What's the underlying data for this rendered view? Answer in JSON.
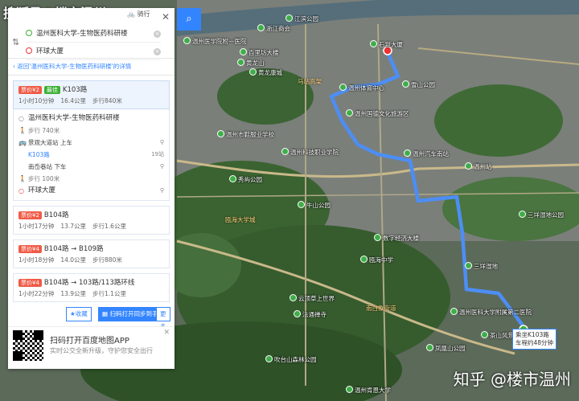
{
  "watermark_top": "搜狐号@楼市温州",
  "watermark_bottom": "知乎 @楼市温州",
  "search": {
    "mode_label": "骑行",
    "start": "温州医科大学-生物医药科研楼",
    "end": "环球大厦"
  },
  "back_link": "返回'温州医科大学-生物医药科研楼'的详情",
  "plans": [
    {
      "badge1": "票价¥2",
      "badge2": "最佳",
      "route": "K103路",
      "time": "1小时10分钟",
      "distance": "16.4公里",
      "walk": "步行840米"
    },
    {
      "badge1": "票价¥2",
      "route": "B104路",
      "time": "1小时17分钟",
      "distance": "13.7公里",
      "walk": "步行1.6公里"
    },
    {
      "badge1": "票价¥4",
      "route": "B104路 → B109路",
      "time": "1小时18分钟",
      "distance": "14.0公里",
      "walk": "步行880米"
    },
    {
      "badge1": "票价¥4",
      "route": "B104路 → 103路/113路环线",
      "time": "1小时22分钟",
      "distance": "13.9公里",
      "walk": "步行1.1公里"
    }
  ],
  "steps": [
    {
      "text": "温州医科大学-生物医药科研楼",
      "right": ""
    },
    {
      "text": "步行 740米",
      "right": ""
    },
    {
      "text": "景观大道站 上车",
      "right": ""
    },
    {
      "text": "K103路",
      "right": "19站"
    },
    {
      "text": "南岙巷站 下车",
      "right": ""
    },
    {
      "text": "步行 100米",
      "right": ""
    },
    {
      "text": "环球大厦",
      "right": ""
    }
  ],
  "actions": {
    "collect": "收藏",
    "send_phone": "扫码打开同步到手机",
    "more": "更多"
  },
  "ad": {
    "title": "扫码打开百度地图APP",
    "subtitle": "实时公交全新升级，守护您安全出行"
  },
  "bubble": {
    "line1": "乘坐K103路",
    "line2": "车程约48分钟"
  },
  "map_labels": [
    "温州医学院附一医院",
    "浙江商会",
    "江滨公园",
    "马站高架",
    "百里坊大楼",
    "黄龙山",
    "黄龙康城",
    "石坦大厦",
    "雪山公园",
    "温州国德文化旅游区",
    "温州汽车南站",
    "温州站",
    "温州市鞋服业学校",
    "温州科技职业学院",
    "牛山公园",
    "瓯海大学城",
    "三垟湿地",
    "温州医科大学附属第二医院",
    "茶山风景区",
    "凤凰山公园",
    "吹台山森林公园",
    "温州肯恩大学",
    "数字经济大楼",
    "南白象街道",
    "云顶草上世界",
    "法通禅寺",
    "秀屿公园",
    "三垟湿地公园",
    "瓯海中学",
    "温州体育中心"
  ],
  "colors": {
    "route": "#4d8ef5",
    "accent": "#3385ff",
    "badge_red": "#f05b47",
    "badge_green": "#3cb035"
  }
}
